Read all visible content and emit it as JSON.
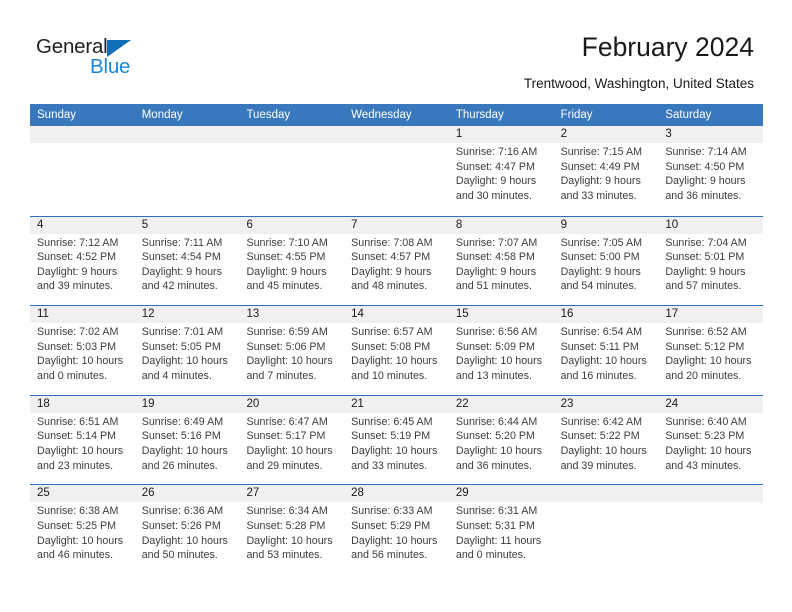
{
  "logo": {
    "word1": "General",
    "word2": "Blue",
    "triangle": "blue-triangle-icon",
    "color_dark": "#231f20",
    "color_blue": "#1a87dd",
    "color_triangle": "#0c6fb8"
  },
  "header": {
    "title": "February 2024",
    "subtitle": "Trentwood, Washington, United States"
  },
  "colors": {
    "header_blue": "#3a78bd",
    "row_divider": "#2f6fb5",
    "day_band": "#f0f0f0",
    "text": "#3d3d3d"
  },
  "weekdays": [
    "Sunday",
    "Monday",
    "Tuesday",
    "Wednesday",
    "Thursday",
    "Friday",
    "Saturday"
  ],
  "weeks": [
    [
      {
        "day": "",
        "empty": true
      },
      {
        "day": "",
        "empty": true
      },
      {
        "day": "",
        "empty": true
      },
      {
        "day": "",
        "empty": true
      },
      {
        "day": "1",
        "sunrise": "Sunrise: 7:16 AM",
        "sunset": "Sunset: 4:47 PM",
        "daylight1": "Daylight: 9 hours",
        "daylight2": "and 30 minutes."
      },
      {
        "day": "2",
        "sunrise": "Sunrise: 7:15 AM",
        "sunset": "Sunset: 4:49 PM",
        "daylight1": "Daylight: 9 hours",
        "daylight2": "and 33 minutes."
      },
      {
        "day": "3",
        "sunrise": "Sunrise: 7:14 AM",
        "sunset": "Sunset: 4:50 PM",
        "daylight1": "Daylight: 9 hours",
        "daylight2": "and 36 minutes."
      }
    ],
    [
      {
        "day": "4",
        "sunrise": "Sunrise: 7:12 AM",
        "sunset": "Sunset: 4:52 PM",
        "daylight1": "Daylight: 9 hours",
        "daylight2": "and 39 minutes."
      },
      {
        "day": "5",
        "sunrise": "Sunrise: 7:11 AM",
        "sunset": "Sunset: 4:54 PM",
        "daylight1": "Daylight: 9 hours",
        "daylight2": "and 42 minutes."
      },
      {
        "day": "6",
        "sunrise": "Sunrise: 7:10 AM",
        "sunset": "Sunset: 4:55 PM",
        "daylight1": "Daylight: 9 hours",
        "daylight2": "and 45 minutes."
      },
      {
        "day": "7",
        "sunrise": "Sunrise: 7:08 AM",
        "sunset": "Sunset: 4:57 PM",
        "daylight1": "Daylight: 9 hours",
        "daylight2": "and 48 minutes."
      },
      {
        "day": "8",
        "sunrise": "Sunrise: 7:07 AM",
        "sunset": "Sunset: 4:58 PM",
        "daylight1": "Daylight: 9 hours",
        "daylight2": "and 51 minutes."
      },
      {
        "day": "9",
        "sunrise": "Sunrise: 7:05 AM",
        "sunset": "Sunset: 5:00 PM",
        "daylight1": "Daylight: 9 hours",
        "daylight2": "and 54 minutes."
      },
      {
        "day": "10",
        "sunrise": "Sunrise: 7:04 AM",
        "sunset": "Sunset: 5:01 PM",
        "daylight1": "Daylight: 9 hours",
        "daylight2": "and 57 minutes."
      }
    ],
    [
      {
        "day": "11",
        "sunrise": "Sunrise: 7:02 AM",
        "sunset": "Sunset: 5:03 PM",
        "daylight1": "Daylight: 10 hours",
        "daylight2": "and 0 minutes."
      },
      {
        "day": "12",
        "sunrise": "Sunrise: 7:01 AM",
        "sunset": "Sunset: 5:05 PM",
        "daylight1": "Daylight: 10 hours",
        "daylight2": "and 4 minutes."
      },
      {
        "day": "13",
        "sunrise": "Sunrise: 6:59 AM",
        "sunset": "Sunset: 5:06 PM",
        "daylight1": "Daylight: 10 hours",
        "daylight2": "and 7 minutes."
      },
      {
        "day": "14",
        "sunrise": "Sunrise: 6:57 AM",
        "sunset": "Sunset: 5:08 PM",
        "daylight1": "Daylight: 10 hours",
        "daylight2": "and 10 minutes."
      },
      {
        "day": "15",
        "sunrise": "Sunrise: 6:56 AM",
        "sunset": "Sunset: 5:09 PM",
        "daylight1": "Daylight: 10 hours",
        "daylight2": "and 13 minutes."
      },
      {
        "day": "16",
        "sunrise": "Sunrise: 6:54 AM",
        "sunset": "Sunset: 5:11 PM",
        "daylight1": "Daylight: 10 hours",
        "daylight2": "and 16 minutes."
      },
      {
        "day": "17",
        "sunrise": "Sunrise: 6:52 AM",
        "sunset": "Sunset: 5:12 PM",
        "daylight1": "Daylight: 10 hours",
        "daylight2": "and 20 minutes."
      }
    ],
    [
      {
        "day": "18",
        "sunrise": "Sunrise: 6:51 AM",
        "sunset": "Sunset: 5:14 PM",
        "daylight1": "Daylight: 10 hours",
        "daylight2": "and 23 minutes."
      },
      {
        "day": "19",
        "sunrise": "Sunrise: 6:49 AM",
        "sunset": "Sunset: 5:16 PM",
        "daylight1": "Daylight: 10 hours",
        "daylight2": "and 26 minutes."
      },
      {
        "day": "20",
        "sunrise": "Sunrise: 6:47 AM",
        "sunset": "Sunset: 5:17 PM",
        "daylight1": "Daylight: 10 hours",
        "daylight2": "and 29 minutes."
      },
      {
        "day": "21",
        "sunrise": "Sunrise: 6:45 AM",
        "sunset": "Sunset: 5:19 PM",
        "daylight1": "Daylight: 10 hours",
        "daylight2": "and 33 minutes."
      },
      {
        "day": "22",
        "sunrise": "Sunrise: 6:44 AM",
        "sunset": "Sunset: 5:20 PM",
        "daylight1": "Daylight: 10 hours",
        "daylight2": "and 36 minutes."
      },
      {
        "day": "23",
        "sunrise": "Sunrise: 6:42 AM",
        "sunset": "Sunset: 5:22 PM",
        "daylight1": "Daylight: 10 hours",
        "daylight2": "and 39 minutes."
      },
      {
        "day": "24",
        "sunrise": "Sunrise: 6:40 AM",
        "sunset": "Sunset: 5:23 PM",
        "daylight1": "Daylight: 10 hours",
        "daylight2": "and 43 minutes."
      }
    ],
    [
      {
        "day": "25",
        "sunrise": "Sunrise: 6:38 AM",
        "sunset": "Sunset: 5:25 PM",
        "daylight1": "Daylight: 10 hours",
        "daylight2": "and 46 minutes."
      },
      {
        "day": "26",
        "sunrise": "Sunrise: 6:36 AM",
        "sunset": "Sunset: 5:26 PM",
        "daylight1": "Daylight: 10 hours",
        "daylight2": "and 50 minutes."
      },
      {
        "day": "27",
        "sunrise": "Sunrise: 6:34 AM",
        "sunset": "Sunset: 5:28 PM",
        "daylight1": "Daylight: 10 hours",
        "daylight2": "and 53 minutes."
      },
      {
        "day": "28",
        "sunrise": "Sunrise: 6:33 AM",
        "sunset": "Sunset: 5:29 PM",
        "daylight1": "Daylight: 10 hours",
        "daylight2": "and 56 minutes."
      },
      {
        "day": "29",
        "sunrise": "Sunrise: 6:31 AM",
        "sunset": "Sunset: 5:31 PM",
        "daylight1": "Daylight: 11 hours",
        "daylight2": "and 0 minutes."
      },
      {
        "day": "",
        "empty": true
      },
      {
        "day": "",
        "empty": true
      }
    ]
  ]
}
